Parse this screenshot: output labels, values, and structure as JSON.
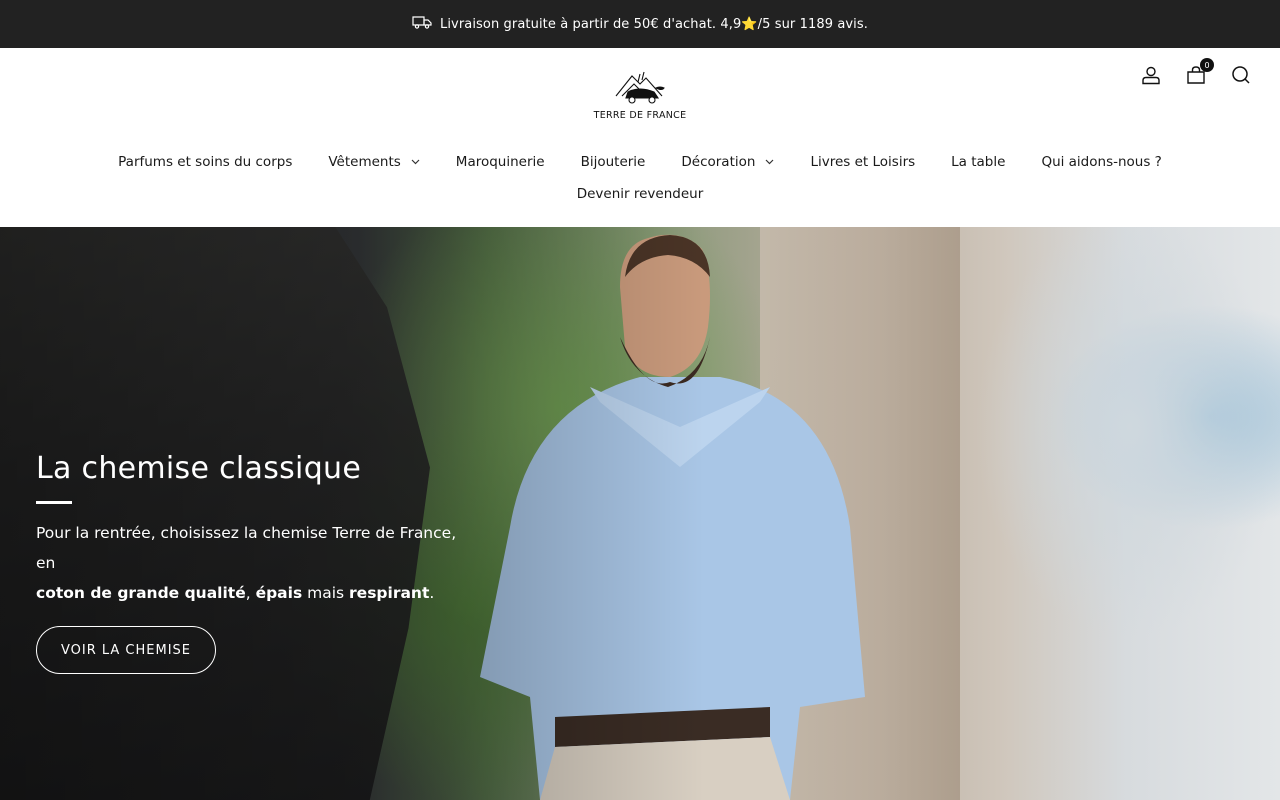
{
  "announcement": {
    "icon": "truck-icon",
    "text": "Livraison gratuite à partir de 50€ d'achat. 4,9⭐/5 sur 1189 avis."
  },
  "header": {
    "logo_text": "TERRE DE FRANCE",
    "icons": {
      "account": "user-icon",
      "cart": "cart-icon",
      "search": "search-icon"
    },
    "cart_count": "0"
  },
  "nav": {
    "items": [
      {
        "label": "Parfums et soins du corps",
        "has_dropdown": false
      },
      {
        "label": "Vêtements",
        "has_dropdown": true
      },
      {
        "label": "Maroquinerie",
        "has_dropdown": false
      },
      {
        "label": "Bijouterie",
        "has_dropdown": false
      },
      {
        "label": "Décoration",
        "has_dropdown": true
      },
      {
        "label": "Livres et Loisirs",
        "has_dropdown": false
      },
      {
        "label": "La table",
        "has_dropdown": false
      },
      {
        "label": "Qui aidons-nous ?",
        "has_dropdown": false
      },
      {
        "label": "Devenir revendeur",
        "has_dropdown": false
      }
    ]
  },
  "hero": {
    "title": "La chemise classique",
    "text_intro": "Pour la rentrée, choisissez la chemise Terre de France, en",
    "text_bold_1": "coton de grande qualité",
    "text_sep_1": ", ",
    "text_bold_2": "épais",
    "text_middle": " mais ",
    "text_bold_3": "respirant",
    "text_end": ".",
    "button_label": "VOIR LA CHEMISE"
  },
  "colors": {
    "announcement_bg": "#222222",
    "text": "#1a1a1a",
    "hero_text": "#ffffff"
  }
}
